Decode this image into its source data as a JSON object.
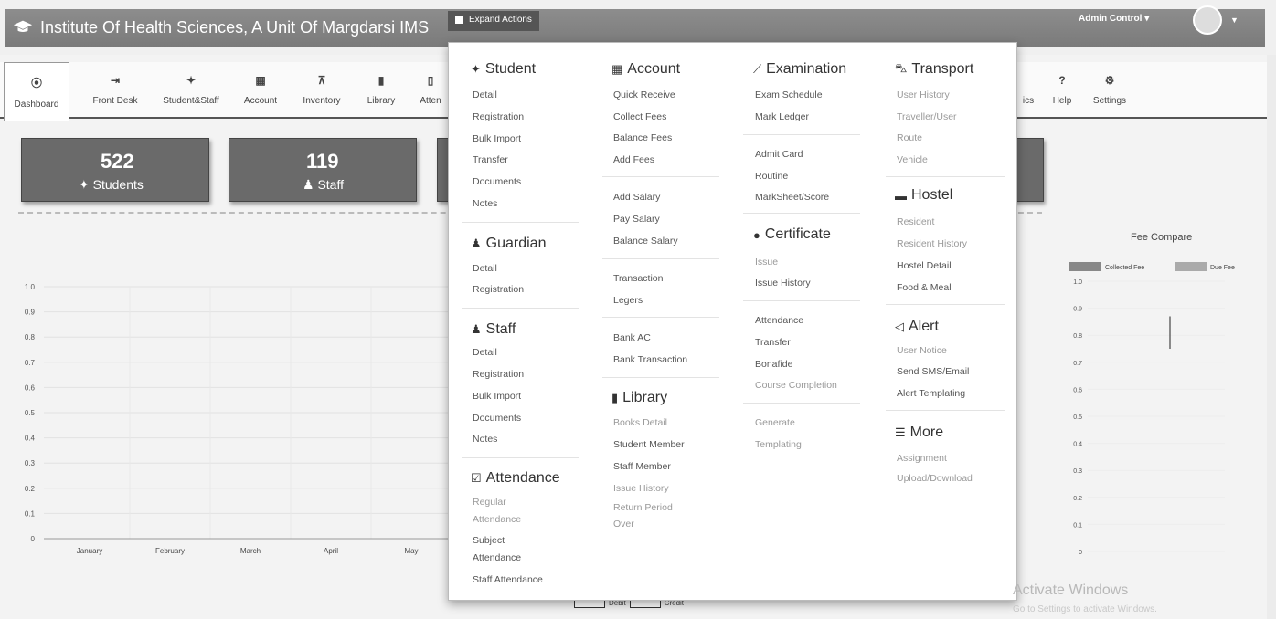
{
  "header": {
    "brand": "Institute Of Health Sciences, A Unit Of Margdarsi IMS",
    "expand_actions": "Expand Actions",
    "admin_control": "Admin Control ▾"
  },
  "nav": [
    {
      "label": "Dashboard",
      "icon": "dashboard-icon",
      "glyph": "⦿"
    },
    {
      "label": "Front Desk",
      "icon": "sign-in-icon",
      "glyph": "⇥"
    },
    {
      "label": "Student&Staff",
      "icon": "users-icon",
      "glyph": "👥"
    },
    {
      "label": "Account",
      "icon": "calculator-icon",
      "glyph": "▦"
    },
    {
      "label": "Inventory",
      "icon": "cart-icon",
      "glyph": "🛒"
    },
    {
      "label": "Library",
      "icon": "book-icon",
      "glyph": "▮"
    },
    {
      "label": "Atten",
      "icon": "calendar-icon",
      "glyph": "▯"
    },
    {
      "label": "ics",
      "icon": "",
      "glyph": ""
    },
    {
      "label": "Help",
      "icon": "question-icon",
      "glyph": "?"
    },
    {
      "label": "Settings",
      "icon": "gear-icon",
      "glyph": "⚙"
    }
  ],
  "cards": [
    {
      "value": "522",
      "label": "Students"
    },
    {
      "value": "119",
      "label": "Staff"
    }
  ],
  "menu": {
    "student": {
      "title": "Student",
      "items": [
        "Detail",
        "Registration",
        "Bulk Import",
        "Transfer",
        "Documents",
        "Notes"
      ]
    },
    "guardian": {
      "title": "Guardian",
      "items": [
        "Detail",
        "Registration"
      ]
    },
    "staff": {
      "title": "Staff",
      "items": [
        "Detail",
        "Registration",
        "Bulk Import",
        "Documents",
        "Notes"
      ]
    },
    "attendance": {
      "title": "Attendance",
      "items": [
        "Regular",
        "Attendance",
        "Subject",
        "Attendance",
        "Staff Attendance"
      ]
    },
    "account": {
      "title": "Account",
      "items": [
        "Quick Receive",
        "Collect Fees",
        "Balance Fees",
        "Add Fees",
        "Add Salary",
        "Pay Salary",
        "Balance Salary",
        "Transaction",
        "Legers",
        "Bank AC",
        "Bank Transaction"
      ]
    },
    "library": {
      "title": "Library",
      "items": [
        "Books Detail",
        "Student Member",
        "Staff Member",
        "Issue History",
        "Return Period",
        "Over"
      ]
    },
    "examination": {
      "title": "Examination",
      "items": [
        "Exam Schedule",
        "Mark Ledger",
        "Admit Card",
        "Routine",
        "MarkSheet/Score"
      ]
    },
    "certificate": {
      "title": "Certificate",
      "items": [
        "Issue",
        "Issue History",
        "Attendance",
        "Transfer",
        "Bonafide",
        "Course Completion",
        "Generate",
        "Templating"
      ]
    },
    "transport": {
      "title": "Transport",
      "items": [
        "User History",
        "Traveller/User",
        "Route",
        "Vehicle"
      ]
    },
    "hostel": {
      "title": "Hostel",
      "items": [
        "Resident",
        "Resident History",
        "Hostel Detail",
        "Food & Meal"
      ]
    },
    "alert": {
      "title": "Alert",
      "items": [
        "User Notice",
        "Send SMS/Email",
        "Alert Templating"
      ]
    },
    "more": {
      "title": "More",
      "items": [
        "Assignment",
        "Upload/Download"
      ]
    }
  },
  "chart_data": [
    {
      "type": "bar",
      "title": "",
      "categories": [
        "January",
        "February",
        "March",
        "April",
        "May"
      ],
      "series": [
        {
          "name": "Debit",
          "values": [
            0,
            0,
            0,
            0,
            0
          ]
        },
        {
          "name": "Credit",
          "values": [
            0,
            0,
            0,
            0,
            0
          ]
        }
      ],
      "ylim": [
        0,
        1.0
      ],
      "yticks": [
        "0",
        "0.1",
        "0.2",
        "0.3",
        "0.4",
        "0.5",
        "0.6",
        "0.7",
        "0.8",
        "0.9",
        "1.0"
      ],
      "grid": true,
      "legend": "bottom"
    },
    {
      "type": "bar",
      "title": "Fee Compare",
      "categories": [],
      "series": [
        {
          "name": "Collected Fee",
          "values": []
        },
        {
          "name": "Due Fee",
          "values": []
        }
      ],
      "ylim": [
        0,
        1.0
      ],
      "yticks": [
        "0",
        "0.1",
        "0.2",
        "0.3",
        "0.4",
        "0.5",
        "0.6",
        "0.7",
        "0.8",
        "0.9",
        "1.0"
      ],
      "legend": "top"
    }
  ],
  "watermark": {
    "line1": "Activate Windows",
    "line2": "Go to Settings to activate Windows."
  }
}
